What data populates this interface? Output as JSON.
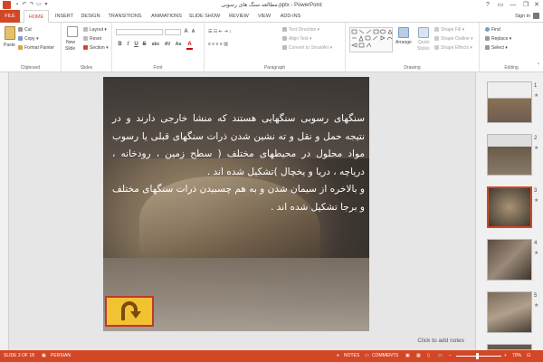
{
  "window": {
    "title": "مطالعه سنگ های رسوبی.pptx - PowerPoint",
    "help": "?",
    "minimize": "—",
    "restore": "❐",
    "close": "✕"
  },
  "tabs": [
    {
      "label": "FILE"
    },
    {
      "label": "HOME"
    },
    {
      "label": "INSERT"
    },
    {
      "label": "DESIGN"
    },
    {
      "label": "TRANSITIONS"
    },
    {
      "label": "ANIMATIONS"
    },
    {
      "label": "SLIDE SHOW"
    },
    {
      "label": "REVIEW"
    },
    {
      "label": "VIEW"
    },
    {
      "label": "ADD-INS"
    }
  ],
  "signin": "Sign in",
  "ribbon": {
    "clipboard": {
      "label": "Clipboard",
      "paste": "Paste",
      "cut": "Cut",
      "copy": "Copy",
      "format_painter": "Format Painter"
    },
    "slides": {
      "label": "Slides",
      "new_slide": "New",
      "new_slide2": "Slide",
      "layout": "Layout",
      "reset": "Reset",
      "section": "Section"
    },
    "font": {
      "label": "Font",
      "bold": "B",
      "italic": "I",
      "underline": "U",
      "strike": "S",
      "shadow": "abc",
      "spacing": "AV",
      "case": "Aa",
      "color": "A"
    },
    "paragraph": {
      "label": "Paragraph",
      "text_direction": "Text Direction",
      "align_text": "Align Text",
      "smartart": "Convert to SmartArt"
    },
    "drawing": {
      "label": "Drawing",
      "arrange": "Arrange",
      "quick_styles": "Quick",
      "quick_styles2": "Styles",
      "shape_fill": "Shape Fill",
      "shape_outline": "Shape Outline",
      "shape_effects": "Shape Effects"
    },
    "editing": {
      "label": "Editing",
      "find": "Find",
      "replace": "Replace",
      "select": "Select"
    }
  },
  "slide": {
    "paragraph1": "سنگهای رسوبی سنگهایی هستند که منشا خارجی دارند و در نتیجه حمل و نقل و ته نشین شدن ذرات سنگهای قبلی یا رسوب مواد محلول در محیطهای مختلف ( سطح زمین ، رودخانه ، دریاچه ، دریا و یخچال )تشکیل شده اند .",
    "paragraph2": "و بالاخره از سیمان شدن و به هم چسبیدن ذرات سنگهای مختلف و برجا تشکیل شده اند ."
  },
  "notes_placeholder": "Click to add notes",
  "thumbnails": [
    {
      "num": "1",
      "star": "★"
    },
    {
      "num": "2",
      "star": "★"
    },
    {
      "num": "3",
      "star": "★"
    },
    {
      "num": "4",
      "star": "★"
    },
    {
      "num": "5",
      "star": "★"
    }
  ],
  "status": {
    "slide_of": "SLIDE 3 OF 18",
    "language": "PERSIAN",
    "notes": "NOTES",
    "comments": "COMMENTS",
    "zoom": "70%"
  },
  "colors": {
    "accent": "#d24726",
    "undo_fill": "#f1c232",
    "undo_border": "#c0392b"
  }
}
